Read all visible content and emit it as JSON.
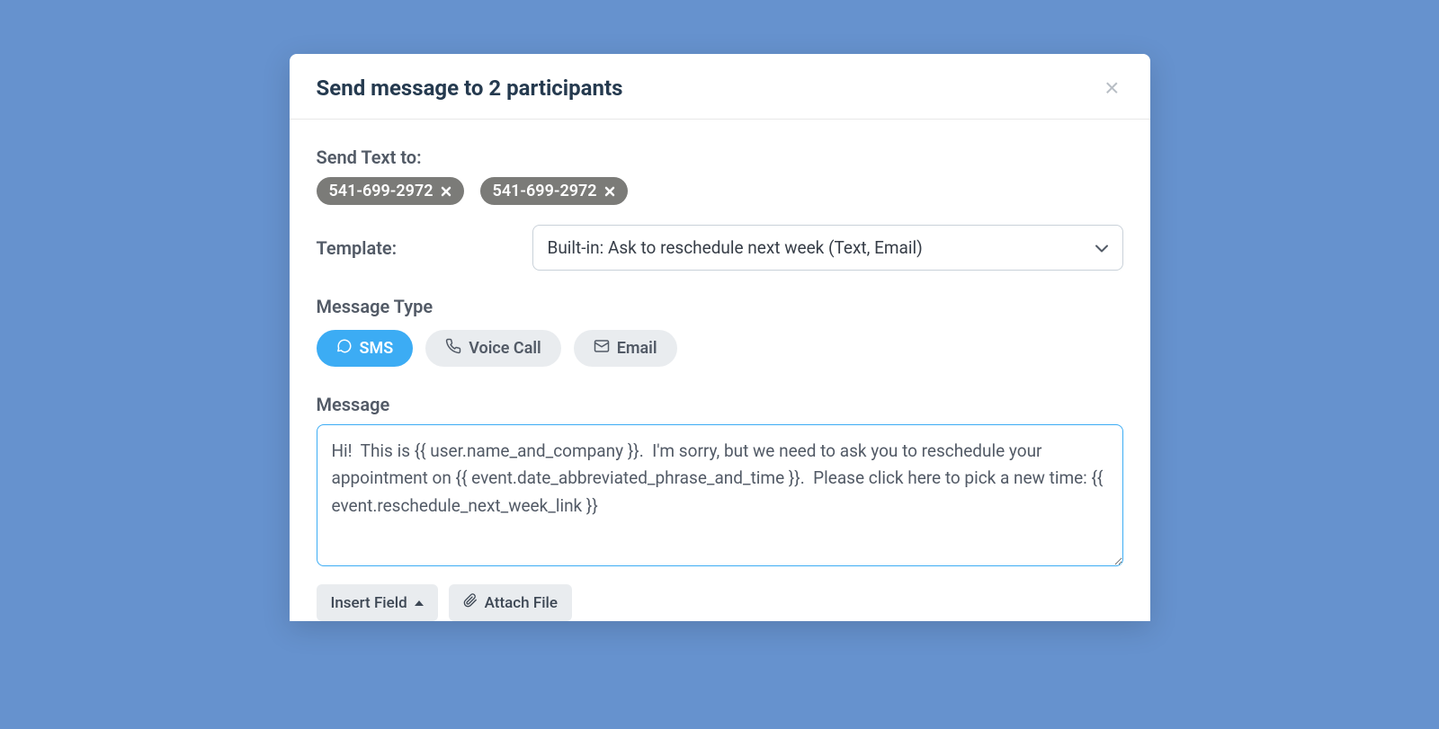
{
  "modal": {
    "title": "Send message to 2 participants"
  },
  "sendTo": {
    "label": "Send Text to:",
    "recipients": [
      "541-699-2972",
      "541-699-2972"
    ]
  },
  "template": {
    "label": "Template:",
    "selected": "Built-in: Ask to reschedule next week (Text, Email)"
  },
  "messageType": {
    "label": "Message Type",
    "options": {
      "sms": "SMS",
      "voice": "Voice Call",
      "email": "Email"
    }
  },
  "message": {
    "label": "Message",
    "body": "Hi!  This is {{ user.name_and_company }}.  I'm sorry, but we need to ask you to reschedule your appointment on {{ event.date_abbreviated_phrase_and_time }}.  Please click here to pick a new time: {{ event.reschedule_next_week_link }}"
  },
  "actions": {
    "insertField": "Insert Field",
    "attachFile": "Attach File"
  }
}
